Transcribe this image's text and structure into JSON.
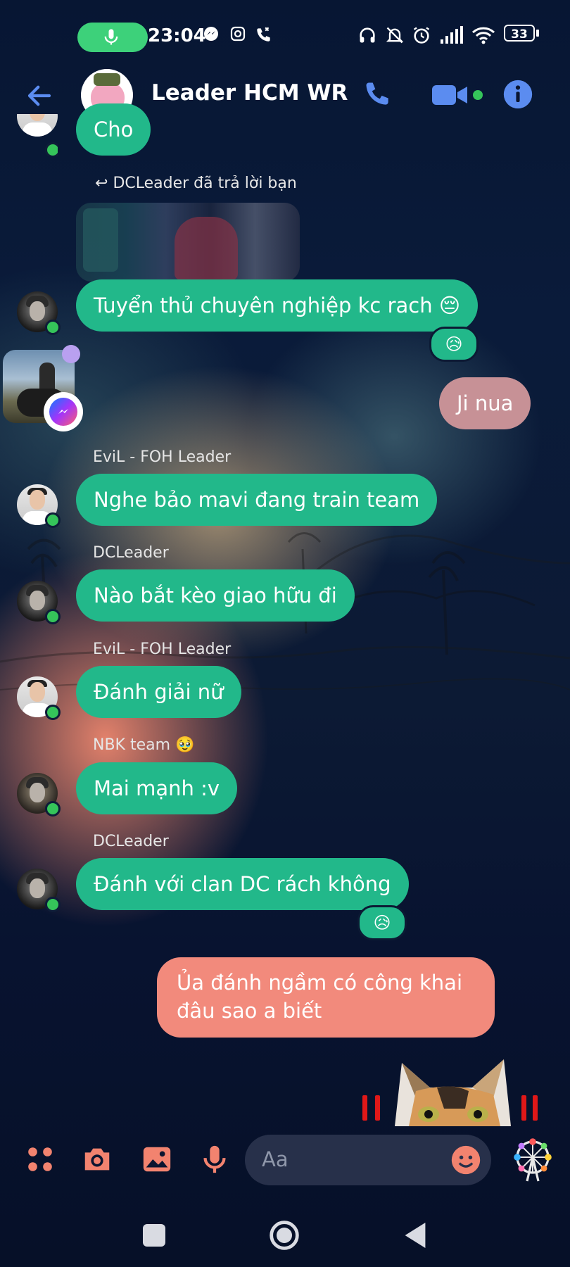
{
  "status_bar": {
    "time": "23:04",
    "battery": "33"
  },
  "header": {
    "title": "Leader HCM WR",
    "back_icon": "arrow-left-icon",
    "call_icon": "phone-icon",
    "video_icon": "video-camera-icon",
    "info_icon": "info-icon"
  },
  "messages": {
    "partial_bubble": "Cho",
    "reply_note": "DCLeader đã trả lời bạn",
    "m1": "Tuyển thủ chuyên nghiệp kc rach 😔",
    "m1_reaction": "😥",
    "m2": "Ji nua",
    "m3_sender": "EviL - FOH Leader",
    "m3": "Nghe bảo mavi đang train team",
    "m4_sender": "DCLeader",
    "m4": "Nào bắt kèo giao hữu đi",
    "m5_sender": "EviL - FOH Leader",
    "m5": "Đánh giải nữ",
    "m6_sender": "NBK team 🥹",
    "m6": "Mai mạnh :v",
    "m7_sender": "DCLeader",
    "m7": "Đánh với clan DC rách không",
    "m7_reaction": "😥",
    "m8": "Ủa đánh ngầm có công khai đâu sao a biết"
  },
  "composer": {
    "placeholder": "Aa",
    "icons": [
      "apps-icon",
      "camera-icon",
      "image-icon",
      "microphone-icon",
      "emoji-icon",
      "ferris-wheel-sticker-icon"
    ]
  },
  "colors": {
    "bubble_incoming": "#22b88a",
    "bubble_outgoing_pink": "#c79196",
    "bubble_outgoing_coral": "#f28a7c",
    "accent_blue": "#5b8cf0",
    "composer_icon": "#f2836f",
    "online": "#35c45a"
  }
}
